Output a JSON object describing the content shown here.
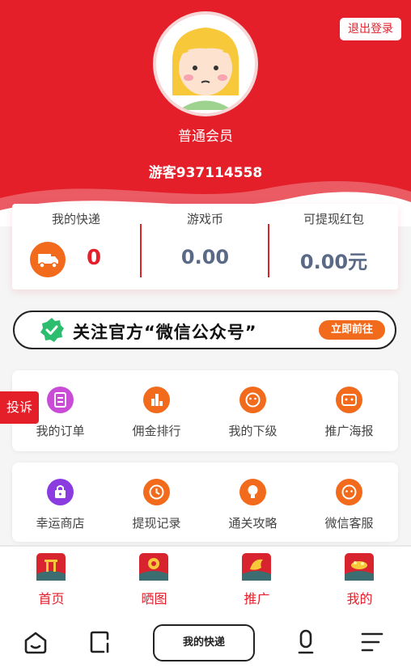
{
  "header": {
    "logout_label": "退出登录",
    "member_level": "普通会员",
    "user_name": "游客937114558"
  },
  "stats": {
    "express": {
      "label": "我的快递",
      "value": "0"
    },
    "coins": {
      "label": "游戏币",
      "value": "0.00"
    },
    "redpacket": {
      "label": "可提现红包",
      "value": "0.00元"
    }
  },
  "follow": {
    "text": "关注官方“微信公众号”",
    "button": "立即前往"
  },
  "grid_row1": [
    {
      "label": "我的订单",
      "icon": "order-icon",
      "color": "#c94cd6"
    },
    {
      "label": "佣金排行",
      "icon": "ranking-icon",
      "color": "#f26a1b"
    },
    {
      "label": "我的下级",
      "icon": "downline-icon",
      "color": "#f26a1b"
    },
    {
      "label": "推广海报",
      "icon": "poster-icon",
      "color": "#f26a1b"
    }
  ],
  "grid_row2": [
    {
      "label": "幸运商店",
      "icon": "shop-icon",
      "color": "#8a3ce0"
    },
    {
      "label": "提现记录",
      "icon": "withdraw-record-icon",
      "color": "#f26a1b"
    },
    {
      "label": "通关攻略",
      "icon": "guide-icon",
      "color": "#f26a1b"
    },
    {
      "label": "微信客服",
      "icon": "customer-service-icon",
      "color": "#f26a1b"
    }
  ],
  "complaint_label": "投诉",
  "tabs": [
    {
      "label": "首页",
      "icon": "home-tab-icon"
    },
    {
      "label": "晒图",
      "icon": "showcase-tab-icon"
    },
    {
      "label": "推广",
      "icon": "promote-tab-icon"
    },
    {
      "label": "我的",
      "icon": "mine-tab-icon"
    }
  ],
  "system_bar": {
    "pill_label": "我的快递"
  },
  "colors": {
    "brand_red": "#e41f2a",
    "accent_orange": "#f26a1b"
  }
}
